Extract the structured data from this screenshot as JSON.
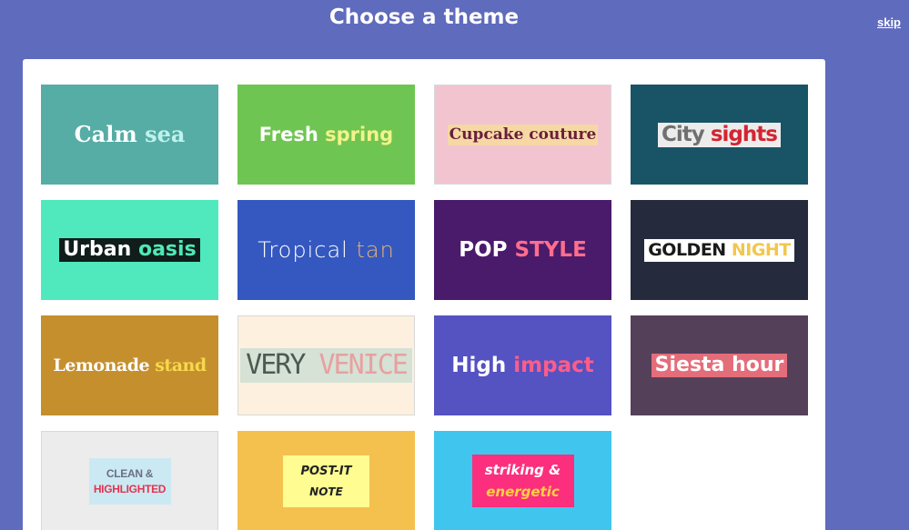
{
  "header": {
    "title": "Choose a theme",
    "skip_label": "skip"
  },
  "themes": [
    {
      "part1": "Calm",
      "part2": "sea"
    },
    {
      "part1": "Fresh",
      "part2": "spring"
    },
    {
      "part1": "Cupcake couture"
    },
    {
      "part1": "City",
      "part2": "sights"
    },
    {
      "part1": "Urban",
      "part2": "oasis"
    },
    {
      "part1": "Tropical",
      "part2": "tan"
    },
    {
      "part1": "POP",
      "part2": "STYLE"
    },
    {
      "part1": "GOLDEN",
      "part2": "NIGHT"
    },
    {
      "part1": "Lemonade",
      "part2": "stand"
    },
    {
      "part1": "VERY",
      "part2": "VENICE"
    },
    {
      "part1": "High",
      "part2": "impact"
    },
    {
      "part1": "Siesta hour"
    },
    {
      "line1": "CLEAN &",
      "line2": "HIGHLIGHTED"
    },
    {
      "line1": "POST-IT",
      "line2": "NOTE"
    },
    {
      "line1": "striking &",
      "line2": "energetic"
    }
  ]
}
